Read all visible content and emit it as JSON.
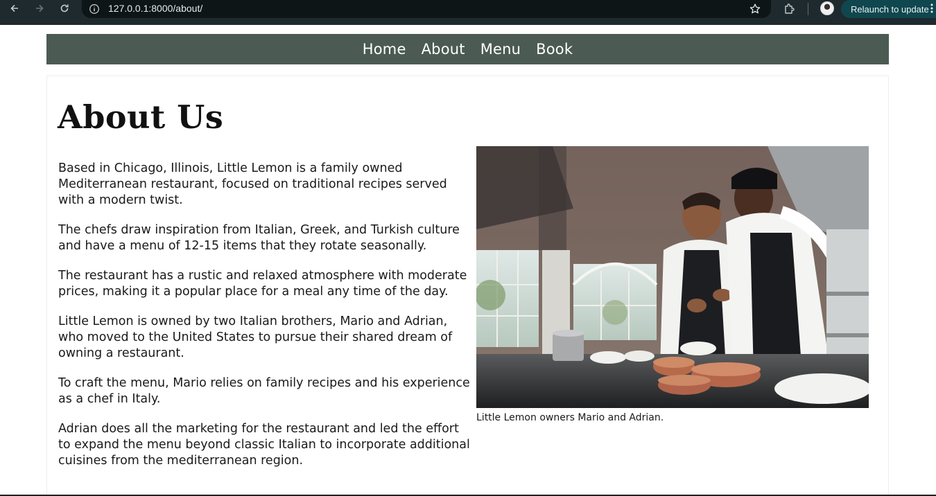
{
  "browser": {
    "url": "127.0.0.1:8000/about/",
    "relaunch_label": "Relaunch to update"
  },
  "nav": {
    "items": [
      {
        "label": "Home"
      },
      {
        "label": "About"
      },
      {
        "label": "Menu"
      },
      {
        "label": "Book"
      }
    ]
  },
  "main": {
    "title": "About Us",
    "paragraphs": [
      "Based in Chicago, Illinois, Little Lemon is a family owned Mediterranean restaurant, focused on traditional recipes served with a modern twist.",
      "The chefs draw inspiration from Italian, Greek, and Turkish culture and have a menu of 12-15 items that they rotate seasonally.",
      "The restaurant has a rustic and relaxed atmosphere with moderate prices, making it a popular place for a meal any time of the day.",
      "Little Lemon is owned by two Italian brothers, Mario and Adrian, who moved to the United States to pursue their shared dream of owning a restaurant.",
      "To craft the menu, Mario relies on family recipes and his experience as a chef in Italy.",
      "Adrian does all the marketing for the restaurant and led the effort to expand the menu beyond classic Italian to incorporate additional cuisines from the mediterranean region."
    ],
    "image_caption": "Little Lemon owners Mario and Adrian."
  },
  "colors": {
    "nav_bg": "#4b5b54",
    "chrome_bg": "#1f2a2e",
    "relaunch_bg": "#10474f"
  }
}
